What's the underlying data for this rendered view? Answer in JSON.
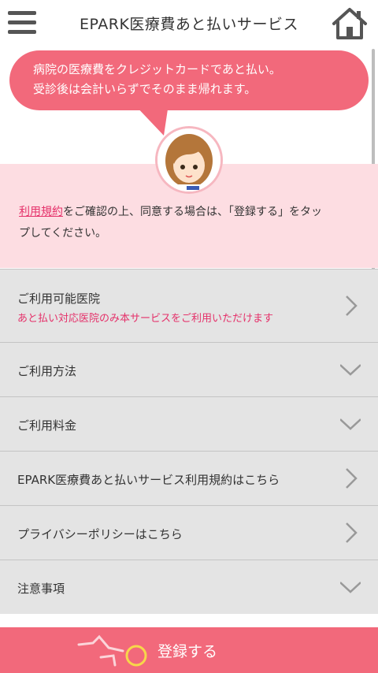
{
  "header": {
    "title": "EPARK医療費あと払いサービス"
  },
  "speech_bubble": {
    "line1": "病院の医療費をクレジットカードであと払い。",
    "line2": "受診後は会計いらずでそのまま帰れます。"
  },
  "notice": {
    "terms_link": "利用規約",
    "text_part1": "をご確認の上、同意する場合は、「登録する」をタッ",
    "text_part2": "プしてください。"
  },
  "menu_items": [
    {
      "label": "ご利用可能医院",
      "sub": "あと払い対応医院のみ本サービスをご利用いただけます",
      "icon": "chevron-right-icon"
    },
    {
      "label": "ご利用方法",
      "icon": "chevron-down-icon"
    },
    {
      "label": "ご利用料金",
      "icon": "chevron-down-icon"
    },
    {
      "label": "EPARK医療費あと払いサービス利用規約はこちら",
      "icon": "chevron-right-icon"
    },
    {
      "label": "プライバシーポリシーはこちら",
      "icon": "chevron-right-icon"
    },
    {
      "label": "注意事項",
      "icon": "chevron-down-icon"
    }
  ],
  "submit": {
    "label": "登録する"
  },
  "colors": {
    "accent": "#f2697b",
    "pink_bg": "#fddde2",
    "link": "#e5316a",
    "row_bg": "#e4e4e4"
  }
}
